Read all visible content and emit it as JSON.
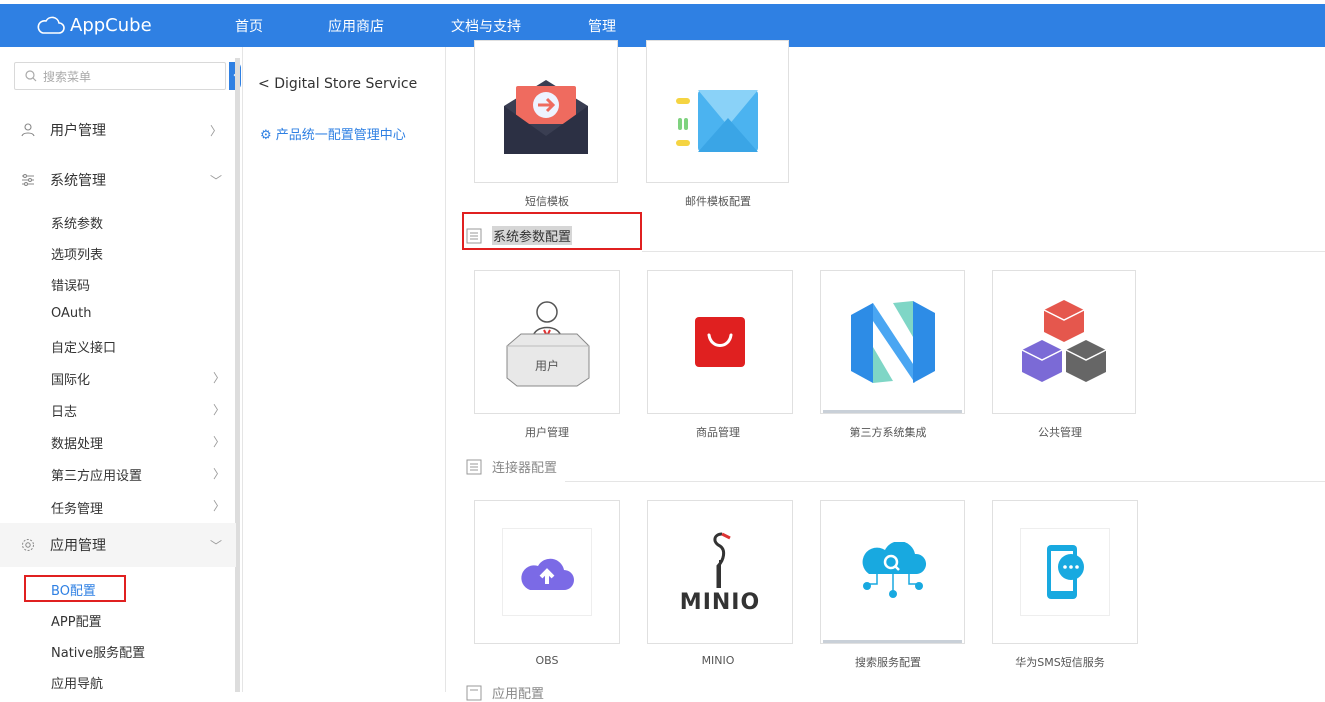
{
  "app": {
    "name": "AppCube"
  },
  "nav": [
    {
      "label": "首页"
    },
    {
      "label": "应用商店"
    },
    {
      "label": "文档与支持"
    },
    {
      "label": "管理"
    }
  ],
  "sidebar": {
    "search_placeholder": "搜索菜单",
    "groups": [
      {
        "label": "用户管理"
      },
      {
        "label": "系统管理"
      },
      {
        "label": "应用管理"
      }
    ],
    "system_items": [
      "系统参数",
      "选项列表",
      "错误码",
      "OAuth",
      "自定义接口",
      "国际化",
      "日志",
      "数据处理",
      "第三方应用设置",
      "任务管理"
    ],
    "app_items": [
      "BO配置",
      "APP配置",
      "Native服务配置",
      "应用导航"
    ]
  },
  "panel": {
    "back_label": "Digital Store Service",
    "config_link": "产品统一配置管理中心"
  },
  "sections": {
    "top_tiles": [
      {
        "label": "短信模板"
      },
      {
        "label": "邮件模板配置"
      }
    ],
    "system_params": {
      "title": "系统参数配置",
      "tiles": [
        {
          "label": "用户管理"
        },
        {
          "label": "商品管理"
        },
        {
          "label": "第三方系统集成"
        },
        {
          "label": "公共管理"
        }
      ]
    },
    "connectors": {
      "title": "连接器配置",
      "tiles": [
        {
          "label": "OBS"
        },
        {
          "label": "MINIO"
        },
        {
          "label": "搜索服务配置"
        },
        {
          "label": "华为SMS短信服务"
        }
      ]
    },
    "app_config": {
      "title": "应用配置"
    }
  },
  "tile_art": {
    "user_box_text": "用户",
    "minio_text": "MINIO"
  },
  "colors": {
    "brand": "#2f80e3",
    "highlight_box": "#e02020"
  }
}
